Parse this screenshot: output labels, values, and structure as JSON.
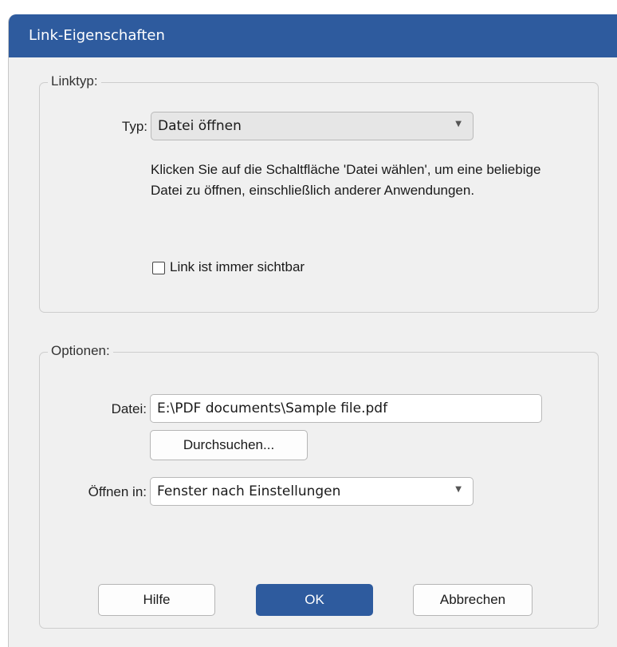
{
  "dialog": {
    "title": "Link-Eigenschaften"
  },
  "linktype": {
    "group_label": "Linktyp:",
    "type_label": "Typ:",
    "type_value": "Datei öffnen",
    "description": "Klicken Sie auf die Schaltfläche 'Datei wählen', um eine beliebige Datei zu öffnen, einschließlich anderer Anwendungen.",
    "always_visible_label": "Link ist immer sichtbar",
    "always_visible_checked": false
  },
  "options": {
    "group_label": "Optionen:",
    "file_label": "Datei:",
    "file_value": "E:\\PDF documents\\Sample file.pdf",
    "browse_label": "Durchsuchen...",
    "open_in_label": "Öffnen in:",
    "open_in_value": "Fenster nach Einstellungen"
  },
  "buttons": {
    "help": "Hilfe",
    "ok": "OK",
    "cancel": "Abbrechen"
  },
  "colors": {
    "accent": "#2e5b9e",
    "dialog_bg": "#f0f0f0"
  },
  "icons": {
    "dropdown": "chevron-down-icon"
  }
}
